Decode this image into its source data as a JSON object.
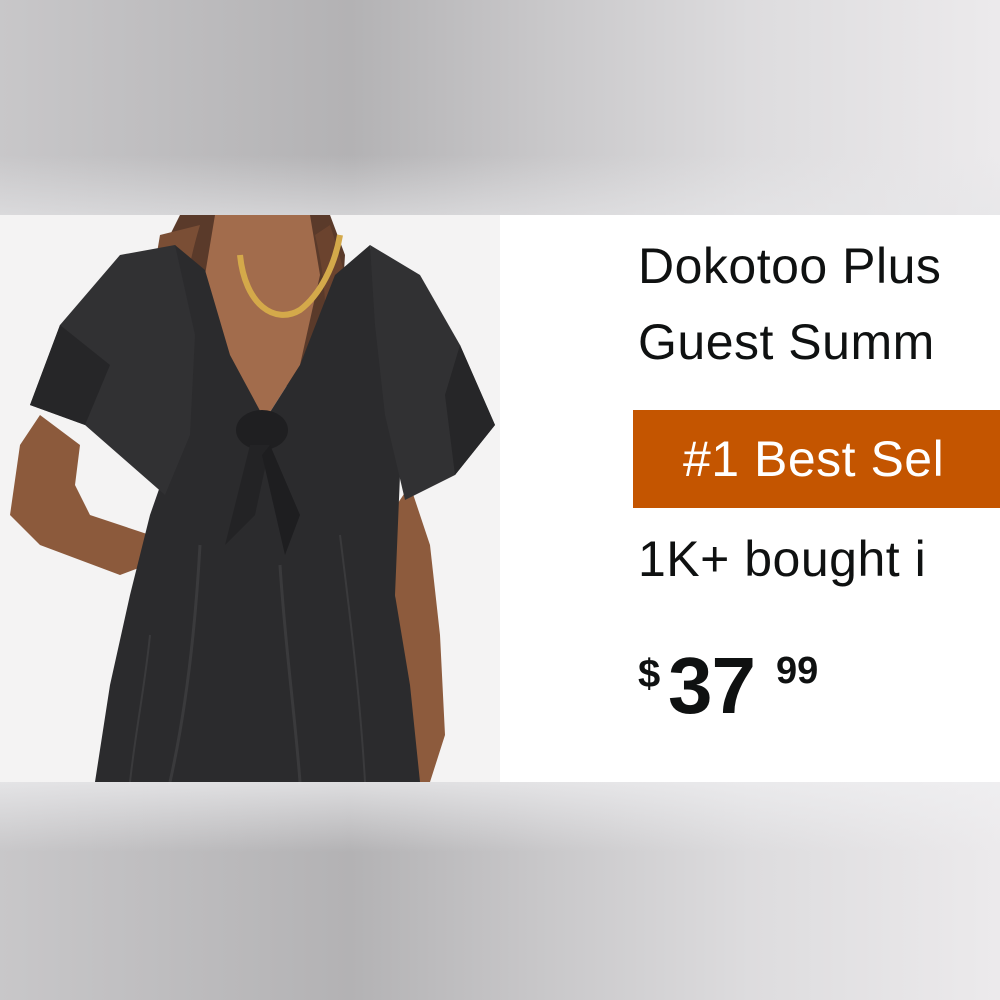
{
  "product": {
    "title_line_1": "Dokotoo Plus",
    "title_line_2": "Guest Summ",
    "badge": "#1 Best Sel",
    "bought": "1K+ bought i",
    "price": {
      "symbol": "$",
      "whole": "37",
      "fraction": "99"
    },
    "image_alt": "Woman wearing a black short-sleeve tie-front dress"
  },
  "colors": {
    "badge_background": "#c45500",
    "badge_text": "#ffffff",
    "text": "#0f1111",
    "dress": "#2b2b2d"
  }
}
